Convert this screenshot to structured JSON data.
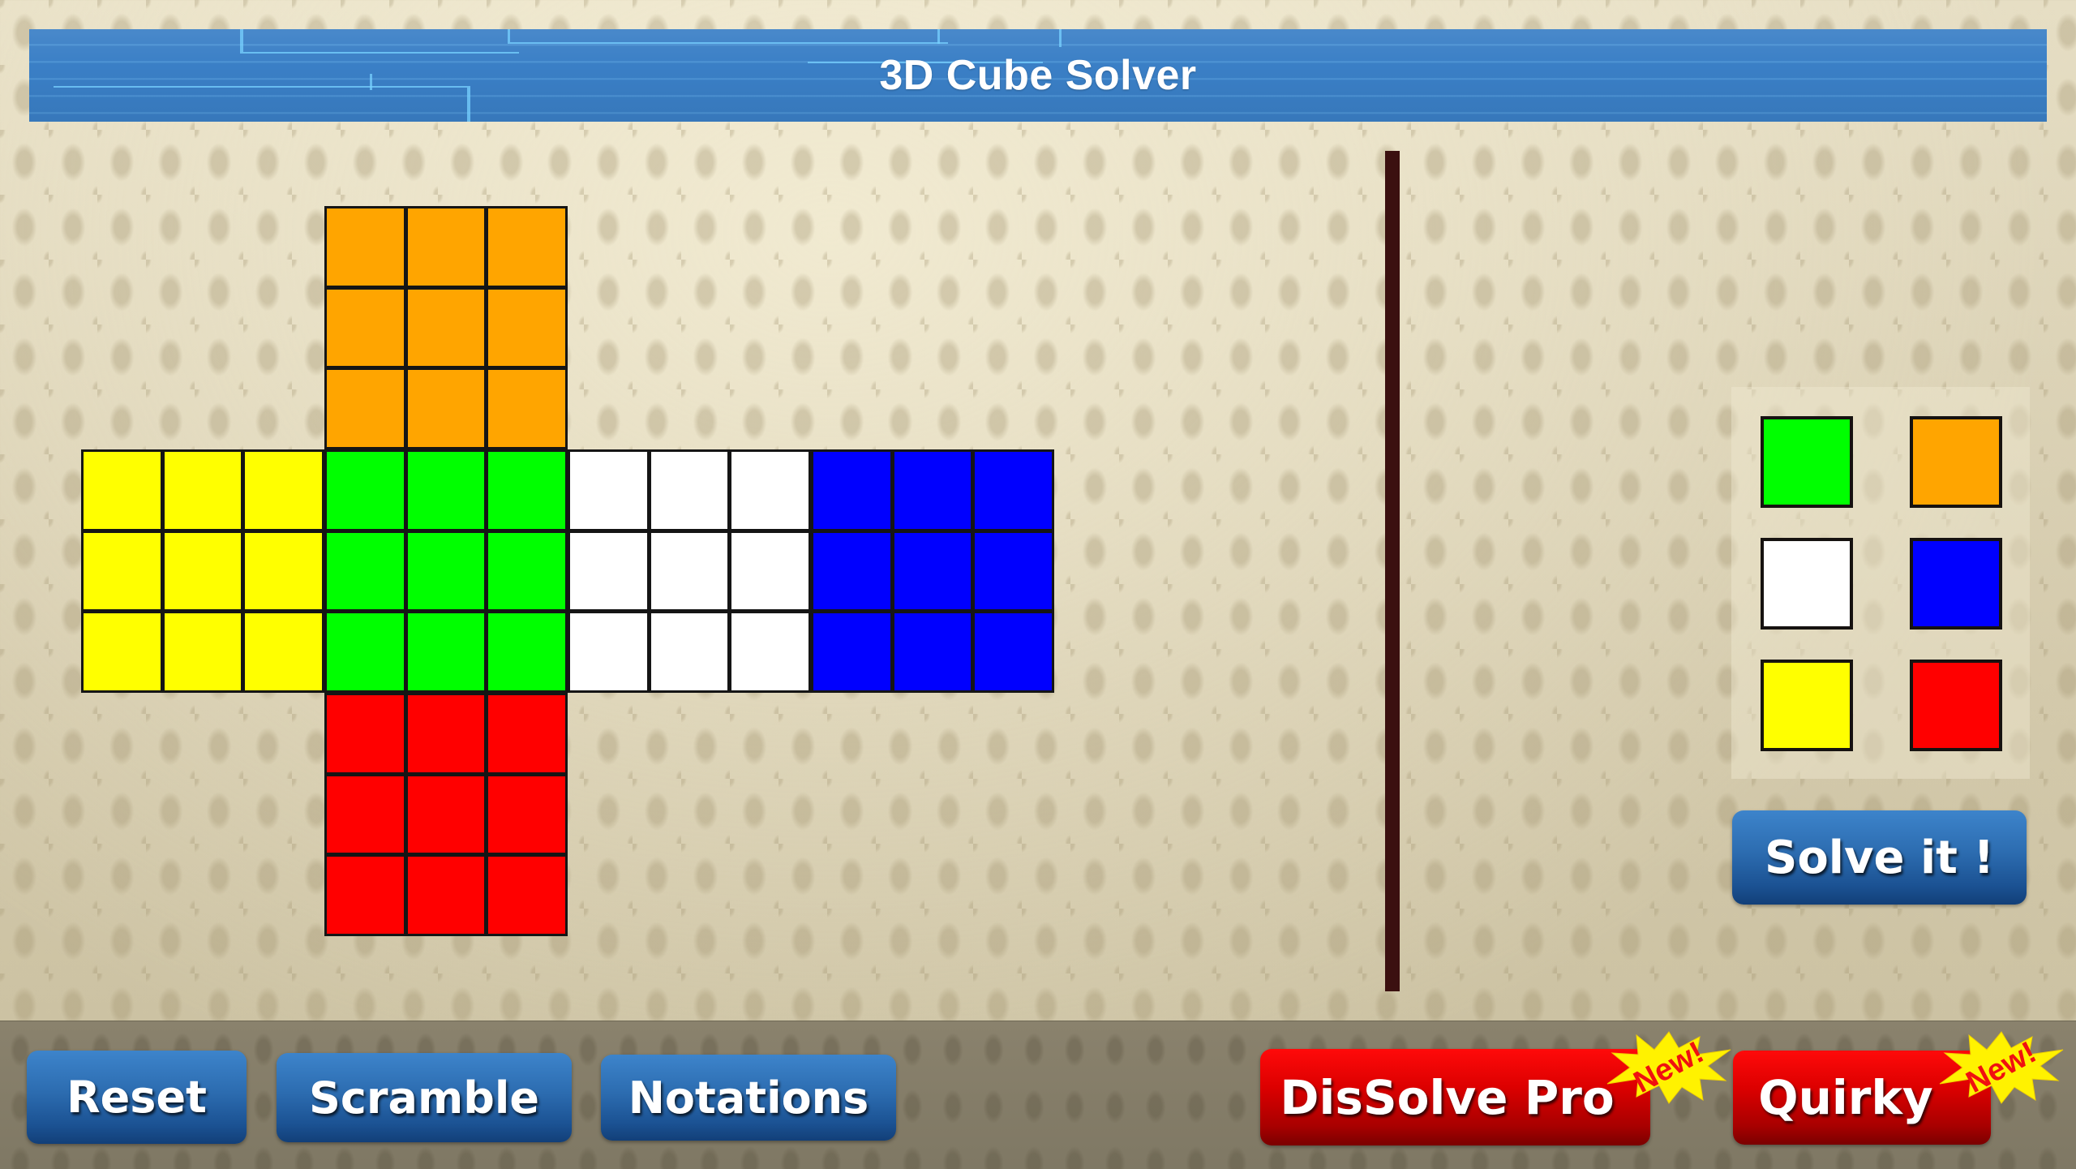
{
  "header": {
    "title": "3D Cube Solver"
  },
  "colors": {
    "orange": "#ffa500",
    "green": "#00ff00",
    "yellow": "#ffff00",
    "white": "#ffffff",
    "blue": "#0000ff",
    "red": "#ff0000"
  },
  "cube": {
    "faces": [
      {
        "name": "top",
        "color_key": "orange",
        "stickers": [
          "orange",
          "orange",
          "orange",
          "orange",
          "orange",
          "orange",
          "orange",
          "orange",
          "orange"
        ]
      },
      {
        "name": "left",
        "color_key": "yellow",
        "stickers": [
          "yellow",
          "yellow",
          "yellow",
          "yellow",
          "yellow",
          "yellow",
          "yellow",
          "yellow",
          "yellow"
        ]
      },
      {
        "name": "front",
        "color_key": "green",
        "stickers": [
          "green",
          "green",
          "green",
          "green",
          "green",
          "green",
          "green",
          "green",
          "green"
        ]
      },
      {
        "name": "right",
        "color_key": "white",
        "stickers": [
          "white",
          "white",
          "white",
          "white",
          "white",
          "white",
          "white",
          "white",
          "white"
        ]
      },
      {
        "name": "back",
        "color_key": "blue",
        "stickers": [
          "blue",
          "blue",
          "blue",
          "blue",
          "blue",
          "blue",
          "blue",
          "blue",
          "blue"
        ]
      },
      {
        "name": "bottom",
        "color_key": "red",
        "stickers": [
          "red",
          "red",
          "red",
          "red",
          "red",
          "red",
          "red",
          "red",
          "red"
        ]
      }
    ]
  },
  "palette": {
    "swatches": [
      "green",
      "orange",
      "white",
      "blue",
      "yellow",
      "red"
    ]
  },
  "actions": {
    "solve_label": "Solve it !"
  },
  "bottom_bar": {
    "reset_label": "Reset",
    "scramble_label": "Scramble",
    "notations_label": "Notations",
    "dissolve_label": "DisSolve Pro",
    "quirky_label": "Quirky",
    "new_badge": "New!"
  }
}
